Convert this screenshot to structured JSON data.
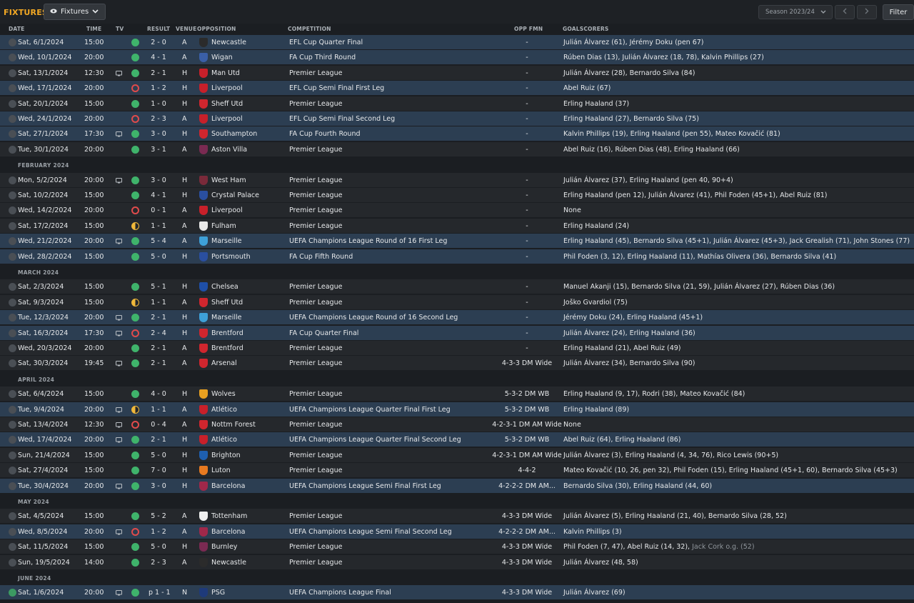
{
  "app": {
    "title": "FIXTURES",
    "view": "Fixtures",
    "season": "Season 2023/24",
    "filter": "Filter"
  },
  "headers": {
    "date": "DATE",
    "time": "TIME",
    "tv": "TV",
    "result": "RESULT",
    "venue": "VENUE",
    "opposition": "OPPOSITION",
    "competition": "COMPETITION",
    "oppfmn": "OPP FMN",
    "goalscorers": "GOALSCORERS"
  },
  "colors": {
    "accent": "#f2a824",
    "win": "#3fb36b",
    "loss": "#e04b4b",
    "draw": "#f0b83a",
    "highlight": "#2c3e52"
  },
  "rows": [
    {
      "type": "match",
      "date": "Sat, 6/1/2024",
      "time": "15:00",
      "tv": false,
      "res": "w",
      "result": "2 - 0",
      "venue": "A",
      "opp": "Newcastle",
      "crest": "#2b2b2b",
      "comp": "EFL Cup Quarter Final",
      "fmn": "-",
      "scorers": "Julián Álvarez (61), Jérémy Doku (pen 67)",
      "style": "hl"
    },
    {
      "type": "match",
      "date": "Wed, 10/1/2024",
      "time": "20:00",
      "tv": false,
      "res": "w",
      "result": "4 - 1",
      "venue": "A",
      "opp": "Wigan",
      "crest": "#3a5fa8",
      "comp": "FA Cup Third Round",
      "fmn": "-",
      "scorers": "Rúben Dias (13), Julián Álvarez (18, 78), Kalvin Phillips (27)",
      "style": "hl"
    },
    {
      "type": "match",
      "date": "Sat, 13/1/2024",
      "time": "12:30",
      "tv": true,
      "res": "w",
      "result": "2 - 1",
      "venue": "H",
      "opp": "Man Utd",
      "crest": "#c8202a",
      "comp": "Premier League",
      "fmn": "-",
      "scorers": "Julián Álvarez (28), Bernardo Silva (84)",
      "style": ""
    },
    {
      "type": "match",
      "date": "Wed, 17/1/2024",
      "time": "20:00",
      "tv": false,
      "res": "l",
      "result": "1 - 2",
      "venue": "H",
      "opp": "Liverpool",
      "crest": "#c8202a",
      "comp": "EFL Cup Semi Final First Leg",
      "fmn": "-",
      "scorers": "Abel Ruiz (67)",
      "style": "hl"
    },
    {
      "type": "match",
      "date": "Sat, 20/1/2024",
      "time": "15:00",
      "tv": false,
      "res": "w",
      "result": "1 - 0",
      "venue": "H",
      "opp": "Sheff Utd",
      "crest": "#d0262e",
      "comp": "Premier League",
      "fmn": "-",
      "scorers": "Erling Haaland (37)",
      "style": ""
    },
    {
      "type": "match",
      "date": "Wed, 24/1/2024",
      "time": "20:00",
      "tv": false,
      "res": "l",
      "result": "2 - 3",
      "venue": "A",
      "opp": "Liverpool",
      "crest": "#c8202a",
      "comp": "EFL Cup Semi Final Second Leg",
      "fmn": "-",
      "scorers": "Erling Haaland (27), Bernardo Silva (75)",
      "style": "hl"
    },
    {
      "type": "match",
      "date": "Sat, 27/1/2024",
      "time": "17:30",
      "tv": true,
      "res": "w",
      "result": "3 - 0",
      "venue": "H",
      "opp": "Southampton",
      "crest": "#d0262e",
      "comp": "FA Cup Fourth Round",
      "fmn": "-",
      "scorers": "Kalvin Phillips (19), Erling Haaland (pen 55), Mateo Kovačić (81)",
      "style": "hl"
    },
    {
      "type": "match",
      "date": "Tue, 30/1/2024",
      "time": "20:00",
      "tv": false,
      "res": "w",
      "result": "3 - 1",
      "venue": "A",
      "opp": "Aston Villa",
      "crest": "#7a2a52",
      "comp": "Premier League",
      "fmn": "-",
      "scorers": "Abel Ruiz (16), Rúben Dias (48), Erling Haaland (66)",
      "style": ""
    },
    {
      "type": "month",
      "label": "FEBRUARY 2024"
    },
    {
      "type": "match",
      "date": "Mon, 5/2/2024",
      "time": "20:00",
      "tv": true,
      "res": "w",
      "result": "3 - 0",
      "venue": "H",
      "opp": "West Ham",
      "crest": "#7a2a3a",
      "comp": "Premier League",
      "fmn": "-",
      "scorers": "Julián Álvarez (37), Erling Haaland (pen 40, 90+4)",
      "style": ""
    },
    {
      "type": "match",
      "date": "Sat, 10/2/2024",
      "time": "15:00",
      "tv": false,
      "res": "w",
      "result": "4 - 1",
      "venue": "H",
      "opp": "Crystal Palace",
      "crest": "#2a4fa0",
      "comp": "Premier League",
      "fmn": "-",
      "scorers": "Erling Haaland (pen 12), Julián Álvarez (41), Phil Foden (45+1), Abel Ruiz (81)",
      "style": ""
    },
    {
      "type": "match",
      "date": "Wed, 14/2/2024",
      "time": "20:00",
      "tv": false,
      "res": "l",
      "result": "0 - 1",
      "venue": "A",
      "opp": "Liverpool",
      "crest": "#c8202a",
      "comp": "Premier League",
      "fmn": "-",
      "scorers": "None",
      "style": ""
    },
    {
      "type": "match",
      "date": "Sat, 17/2/2024",
      "time": "15:00",
      "tv": false,
      "res": "d",
      "result": "1 - 1",
      "venue": "A",
      "opp": "Fulham",
      "crest": "#e8e8e8",
      "comp": "Premier League",
      "fmn": "-",
      "scorers": "Erling Haaland (24)",
      "style": ""
    },
    {
      "type": "match",
      "date": "Wed, 21/2/2024",
      "time": "20:00",
      "tv": true,
      "res": "w",
      "result": "5 - 4",
      "venue": "A",
      "opp": "Marseille",
      "crest": "#3ea0d8",
      "comp": "UEFA Champions League Round of 16 First Leg",
      "fmn": "-",
      "scorers": "Erling Haaland (45), Bernardo Silva (45+1), Julián Álvarez (45+3), Jack Grealish (71), John Stones (77)",
      "style": "hl"
    },
    {
      "type": "match",
      "date": "Wed, 28/2/2024",
      "time": "15:00",
      "tv": false,
      "res": "w",
      "result": "5 - 0",
      "venue": "H",
      "opp": "Portsmouth",
      "crest": "#2a4fa0",
      "comp": "FA Cup Fifth Round",
      "fmn": "-",
      "scorers": "Phil Foden (3, 12), Erling Haaland (11), Mathías Olivera (36), Bernardo Silva (41)",
      "style": "hl"
    },
    {
      "type": "month",
      "label": "MARCH 2024"
    },
    {
      "type": "match",
      "date": "Sat, 2/3/2024",
      "time": "15:00",
      "tv": false,
      "res": "w",
      "result": "5 - 1",
      "venue": "H",
      "opp": "Chelsea",
      "crest": "#1e4fa8",
      "comp": "Premier League",
      "fmn": "-",
      "scorers": "Manuel Akanji (15), Bernardo Silva (21, 59), Julián Álvarez (27), Rúben Dias (36)",
      "style": ""
    },
    {
      "type": "match",
      "date": "Sat, 9/3/2024",
      "time": "15:00",
      "tv": false,
      "res": "d",
      "result": "1 - 1",
      "venue": "A",
      "opp": "Sheff Utd",
      "crest": "#d0262e",
      "comp": "Premier League",
      "fmn": "-",
      "scorers": "Joško Gvardiol (75)",
      "style": ""
    },
    {
      "type": "match",
      "date": "Tue, 12/3/2024",
      "time": "20:00",
      "tv": true,
      "res": "w",
      "result": "2 - 1",
      "venue": "H",
      "opp": "Marseille",
      "crest": "#3ea0d8",
      "comp": "UEFA Champions League Round of 16 Second Leg",
      "fmn": "-",
      "scorers": "Jérémy Doku (24), Erling Haaland (45+1)",
      "style": "hl"
    },
    {
      "type": "match",
      "date": "Sat, 16/3/2024",
      "time": "17:30",
      "tv": true,
      "res": "l",
      "result": "2 - 4",
      "venue": "H",
      "opp": "Brentford",
      "crest": "#d0262e",
      "comp": "FA Cup Quarter Final",
      "fmn": "-",
      "scorers": "Julián Álvarez (24), Erling Haaland (36)",
      "style": "hl"
    },
    {
      "type": "match",
      "date": "Wed, 20/3/2024",
      "time": "20:00",
      "tv": false,
      "res": "w",
      "result": "2 - 1",
      "venue": "A",
      "opp": "Brentford",
      "crest": "#d0262e",
      "comp": "Premier League",
      "fmn": "-",
      "scorers": "Erling Haaland (21), Abel Ruiz (49)",
      "style": ""
    },
    {
      "type": "match",
      "date": "Sat, 30/3/2024",
      "time": "19:45",
      "tv": true,
      "res": "w",
      "result": "2 - 1",
      "venue": "A",
      "opp": "Arsenal",
      "crest": "#d0262e",
      "comp": "Premier League",
      "fmn": "4-3-3 DM Wide",
      "scorers": "Julián Álvarez (34), Bernardo Silva (90)",
      "style": ""
    },
    {
      "type": "month",
      "label": "APRIL 2024"
    },
    {
      "type": "match",
      "date": "Sat, 6/4/2024",
      "time": "15:00",
      "tv": false,
      "res": "w",
      "result": "4 - 0",
      "venue": "H",
      "opp": "Wolves",
      "crest": "#e8a020",
      "comp": "Premier League",
      "fmn": "5-3-2 DM WB",
      "scorers": "Erling Haaland (9, 17), Rodri (38), Mateo Kovačić (84)",
      "style": ""
    },
    {
      "type": "match",
      "date": "Tue, 9/4/2024",
      "time": "20:00",
      "tv": true,
      "res": "d",
      "result": "1 - 1",
      "venue": "A",
      "opp": "Atlético",
      "crest": "#c8202a",
      "comp": "UEFA Champions League Quarter Final First Leg",
      "fmn": "5-3-2 DM WB",
      "scorers": "Erling Haaland (89)",
      "style": "hl"
    },
    {
      "type": "match",
      "date": "Sat, 13/4/2024",
      "time": "12:30",
      "tv": true,
      "res": "l",
      "result": "0 - 4",
      "venue": "A",
      "opp": "Nottm Forest",
      "crest": "#d0262e",
      "comp": "Premier League",
      "fmn": "4-2-3-1 DM AM Wide",
      "scorers": "None",
      "style": ""
    },
    {
      "type": "match",
      "date": "Wed, 17/4/2024",
      "time": "20:00",
      "tv": true,
      "res": "w",
      "result": "2 - 1",
      "venue": "H",
      "opp": "Atlético",
      "crest": "#c8202a",
      "comp": "UEFA Champions League Quarter Final Second Leg",
      "fmn": "5-3-2 DM WB",
      "scorers": "Abel Ruiz (64), Erling Haaland (86)",
      "style": "hl"
    },
    {
      "type": "match",
      "date": "Sun, 21/4/2024",
      "time": "15:00",
      "tv": false,
      "res": "w",
      "result": "5 - 0",
      "venue": "H",
      "opp": "Brighton",
      "crest": "#1e5fb0",
      "comp": "Premier League",
      "fmn": "4-2-3-1 DM AM Wide",
      "scorers": "Julián Álvarez (3), Erling Haaland (4, 34, 76), Rico Lewis (90+5)",
      "style": ""
    },
    {
      "type": "match",
      "date": "Sat, 27/4/2024",
      "time": "15:00",
      "tv": false,
      "res": "w",
      "result": "7 - 0",
      "venue": "H",
      "opp": "Luton",
      "crest": "#e87a20",
      "comp": "Premier League",
      "fmn": "4-4-2",
      "scorers": "Mateo Kovačić (10, 26, pen 32), Phil Foden (15), Erling Haaland (45+1, 60), Bernardo Silva (45+3)",
      "style": ""
    },
    {
      "type": "match",
      "date": "Tue, 30/4/2024",
      "time": "20:00",
      "tv": true,
      "res": "w",
      "result": "3 - 0",
      "venue": "H",
      "opp": "Barcelona",
      "crest": "#a0284a",
      "comp": "UEFA Champions League Semi Final First Leg",
      "fmn": "4-2-2-2 DM AM...",
      "scorers": "Bernardo Silva (30), Erling Haaland (44, 60)",
      "style": "hl"
    },
    {
      "type": "month",
      "label": "MAY 2024"
    },
    {
      "type": "match",
      "date": "Sat, 4/5/2024",
      "time": "15:00",
      "tv": false,
      "res": "w",
      "result": "5 - 2",
      "venue": "A",
      "opp": "Tottenham",
      "crest": "#f0f0f0",
      "comp": "Premier League",
      "fmn": "4-3-3 DM Wide",
      "scorers": "Julián Álvarez (5), Erling Haaland (21, 40), Bernardo Silva (28, 52)",
      "style": ""
    },
    {
      "type": "match",
      "date": "Wed, 8/5/2024",
      "time": "20:00",
      "tv": true,
      "res": "l",
      "result": "1 - 2",
      "venue": "A",
      "opp": "Barcelona",
      "crest": "#a0284a",
      "comp": "UEFA Champions League Semi Final Second Leg",
      "fmn": "4-2-2-2 DM AM...",
      "scorers": "Kalvin Phillips (3)",
      "style": "hl"
    },
    {
      "type": "match",
      "date": "Sat, 11/5/2024",
      "time": "15:00",
      "tv": false,
      "res": "w",
      "result": "5 - 0",
      "venue": "H",
      "opp": "Burnley",
      "crest": "#7a2a52",
      "comp": "Premier League",
      "fmn": "4-3-3 DM Wide",
      "scorers": "Phil Foden (7, 47), Abel Ruiz (14, 32), ",
      "scorers_og": "Jack Cork o.g. (52)",
      "style": ""
    },
    {
      "type": "match",
      "date": "Sun, 19/5/2024",
      "time": "14:00",
      "tv": false,
      "res": "w",
      "result": "2 - 3",
      "venue": "A",
      "opp": "Newcastle",
      "crest": "#2b2b2b",
      "comp": "Premier League",
      "fmn": "4-3-3 DM Wide",
      "scorers": "Julián Álvarez (48, 58)",
      "style": ""
    },
    {
      "type": "month",
      "label": "JUNE 2024"
    },
    {
      "type": "match",
      "date": "Sat, 1/6/2024",
      "time": "20:00",
      "tv": true,
      "res": "w",
      "result": "p 1 - 1",
      "venue": "N",
      "opp": "PSG",
      "crest": "#1e3a7a",
      "comp": "UEFA Champions League Final",
      "fmn": "4-3-3 DM Wide",
      "scorers": "Julián Álvarez (69)",
      "style": "hl",
      "checked": true
    }
  ]
}
